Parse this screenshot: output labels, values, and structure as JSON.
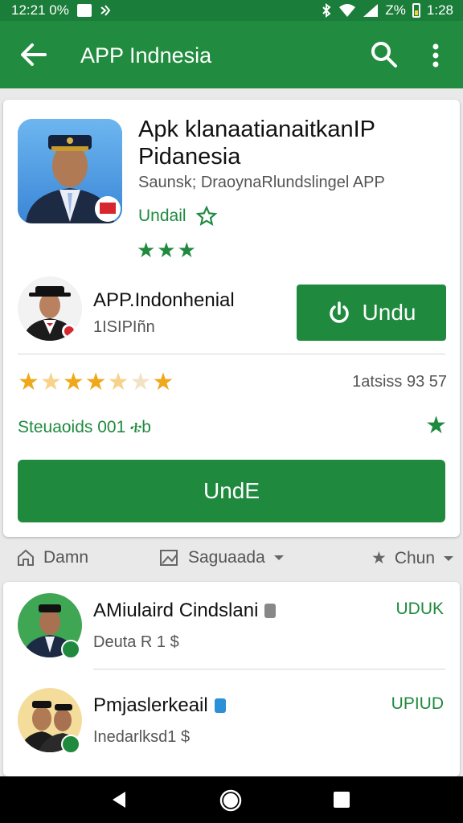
{
  "status_bar": {
    "time": "12:21 0%",
    "battery": "Z%",
    "clock_right": "1:28"
  },
  "app_bar": {
    "title": "APP Indnesia"
  },
  "app": {
    "title": "Apk klanaatianaitkanIP Pidanesia",
    "subtitle": "Saunsk; DraoynaRlundslingel APP",
    "category": "Undail",
    "stars": "★★★"
  },
  "developer": {
    "name": "APP.Indonhenial",
    "sub": "1ISIPIñn"
  },
  "install_button": {
    "label": "Undu"
  },
  "rating": {
    "count": "1atsiss 93 57"
  },
  "downloads": {
    "label": "Steuaoids 001 ቴb"
  },
  "main_button": {
    "label": "UndE"
  },
  "filters": [
    {
      "label": "Damn"
    },
    {
      "label": "Saguaada"
    },
    {
      "label": "Chun"
    }
  ],
  "related": [
    {
      "title": "AMiulaird Cindslani",
      "sub": "Deuta R 1 $",
      "action": "UDUK"
    },
    {
      "title": "Pmjaslerkeail",
      "sub": "Inedarlksd1 $",
      "action": "UPIUD"
    }
  ],
  "colors": {
    "primary": "#218c3f",
    "status": "#1b7d3a",
    "accent": "#1f8a3e",
    "star": "#f0a81b"
  }
}
